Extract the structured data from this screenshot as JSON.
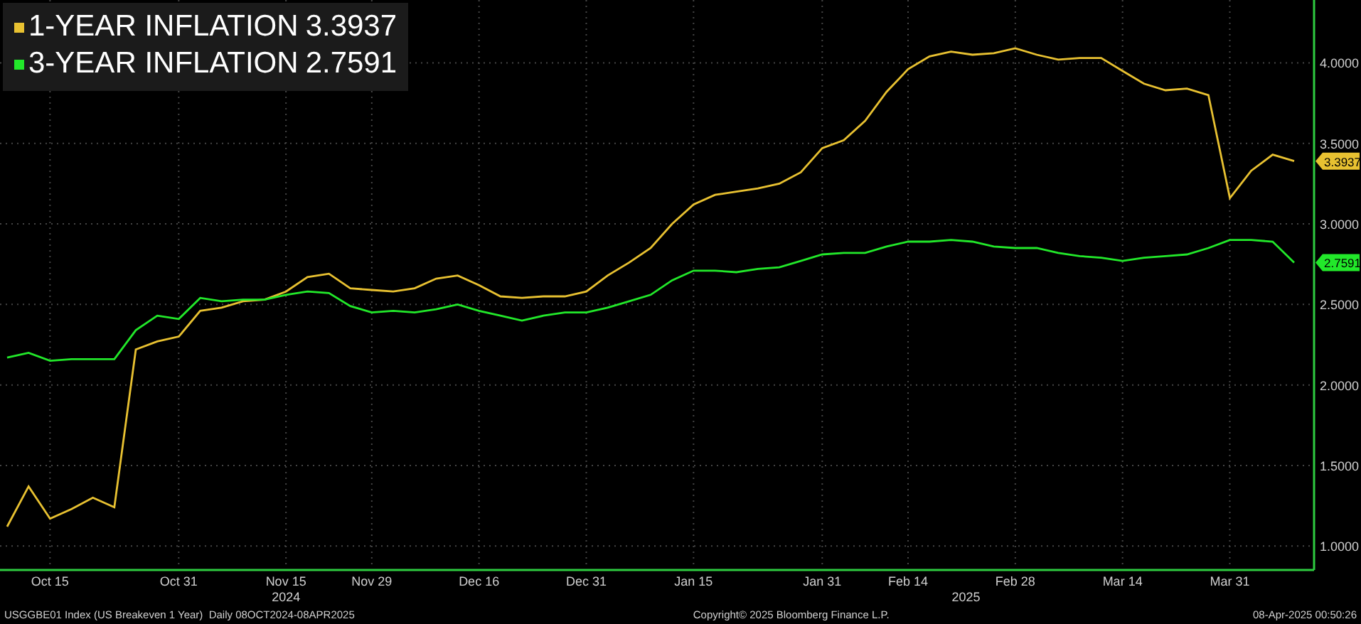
{
  "chart_data": {
    "type": "line",
    "categories": [
      null,
      null,
      "Oct 15",
      null,
      null,
      null,
      null,
      null,
      "Oct 31",
      null,
      null,
      null,
      null,
      "Nov 15",
      null,
      null,
      null,
      "Nov 29",
      null,
      null,
      null,
      null,
      "Dec 16",
      null,
      null,
      null,
      null,
      "Dec 31",
      null,
      null,
      null,
      null,
      "Jan 15",
      null,
      null,
      null,
      null,
      null,
      "Jan 31",
      null,
      null,
      null,
      "Feb 14",
      null,
      null,
      null,
      null,
      "Feb 28",
      null,
      null,
      null,
      null,
      "Mar 14",
      null,
      null,
      null,
      null,
      "Mar 31",
      null,
      null,
      null
    ],
    "series": [
      {
        "name": "1-YEAR INFLATION",
        "color": "#e8c131",
        "values": [
          1.12,
          1.37,
          1.17,
          1.23,
          1.3,
          1.24,
          2.22,
          2.27,
          2.3,
          2.46,
          2.48,
          2.52,
          2.53,
          2.58,
          2.67,
          2.69,
          2.6,
          2.59,
          2.58,
          2.6,
          2.66,
          2.68,
          2.62,
          2.55,
          2.54,
          2.55,
          2.55,
          2.58,
          2.68,
          2.76,
          2.85,
          3.0,
          3.12,
          3.18,
          3.2,
          3.22,
          3.25,
          3.32,
          3.47,
          3.52,
          3.64,
          3.82,
          3.96,
          4.04,
          4.07,
          4.05,
          4.06,
          4.09,
          4.05,
          4.02,
          4.03,
          4.03,
          3.95,
          3.87,
          3.83,
          3.84,
          3.8,
          3.16,
          3.33,
          3.43,
          3.39
        ]
      },
      {
        "name": "3-YEAR INFLATION",
        "color": "#22e82a",
        "values": [
          2.17,
          2.2,
          2.15,
          2.16,
          2.16,
          2.16,
          2.34,
          2.43,
          2.41,
          2.54,
          2.52,
          2.53,
          2.53,
          2.56,
          2.58,
          2.57,
          2.49,
          2.45,
          2.46,
          2.45,
          2.47,
          2.5,
          2.46,
          2.43,
          2.4,
          2.43,
          2.45,
          2.45,
          2.48,
          2.52,
          2.56,
          2.65,
          2.71,
          2.71,
          2.7,
          2.72,
          2.73,
          2.77,
          2.81,
          2.82,
          2.82,
          2.86,
          2.89,
          2.89,
          2.9,
          2.89,
          2.86,
          2.85,
          2.85,
          2.82,
          2.8,
          2.79,
          2.77,
          2.79,
          2.8,
          2.81,
          2.85,
          2.9,
          2.9,
          2.89,
          2.76
        ]
      }
    ],
    "ylim": [
      0.86,
      4.39
    ],
    "grid": true,
    "legend": "top-left",
    "yticks": [
      {
        "value": 1,
        "label": "1.0000"
      },
      {
        "value": 1.5,
        "label": "1.5000"
      },
      {
        "value": 2,
        "label": "2.0000"
      },
      {
        "value": 2.5,
        "label": "2.5000"
      },
      {
        "value": 3,
        "label": "3.0000"
      },
      {
        "value": 3.5,
        "label": "3.5000"
      },
      {
        "value": 4,
        "label": "4.0000"
      }
    ]
  },
  "year_labels": [
    "2024",
    "2025"
  ],
  "legend_values": [
    "3.3937",
    "2.7591"
  ],
  "axis_tags": [
    "3.3937",
    "2.7591"
  ],
  "footer": {
    "security": "USGGBE01 Index (US Breakeven 1 Year)  Daily 08OCT2024-08APR2025",
    "copyright": "Copyright© 2025 Bloomberg Finance L.P.",
    "timestamp": "08-Apr-2025 00:50:26"
  }
}
